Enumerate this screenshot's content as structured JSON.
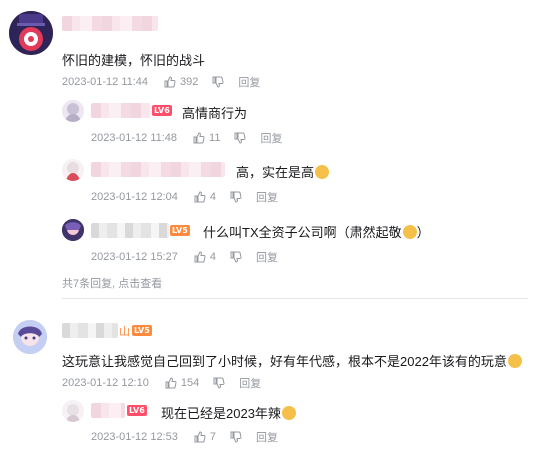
{
  "comments": [
    {
      "id": "c1",
      "content": "怀旧的建模，怀旧的战斗",
      "time": "2023-01-12 11:44",
      "likes": "392",
      "reply_label": "回复",
      "replies": [
        {
          "name_suffix": "",
          "level": "LV6",
          "content": "高情商行为",
          "time": "2023-01-12 11:48",
          "likes": "11",
          "reply_label": "回复"
        },
        {
          "name_suffix": "",
          "level": "",
          "content": "高，实在是高",
          "emoji": "doge-emoji",
          "time": "2023-01-12 12:04",
          "likes": "4",
          "reply_label": "回复"
        },
        {
          "name_suffix": "",
          "level": "LV5",
          "content": "什么叫TX全资子公司啊（肃然起敬",
          "emoji": "smile-emoji",
          "content_end": "）",
          "time": "2023-01-12 15:27",
          "likes": "4",
          "reply_label": "回复"
        }
      ],
      "more_text": "共7条回复, 点击查看"
    },
    {
      "id": "c2",
      "name_suffix": "山",
      "level": "LV5",
      "content": "这玩意让我感觉自己回到了小时候，好有年代感，根本不是2022年该有的玩意",
      "emoji": "laugh-emoji",
      "time": "2023-01-12 12:10",
      "likes": "154",
      "reply_label": "回复",
      "replies": [
        {
          "name_suffix": "",
          "level": "LV6",
          "content": "现在已经是2023年辣",
          "emoji": "doge-emoji",
          "time": "2023-01-12 12:53",
          "likes": "7",
          "reply_label": "回复"
        }
      ]
    }
  ],
  "colors": {
    "text": "#18191c",
    "meta": "#9499a0",
    "lv6": "#ff4f6a",
    "lv5": "#ff8a3d",
    "divider": "#e3e5e7"
  }
}
